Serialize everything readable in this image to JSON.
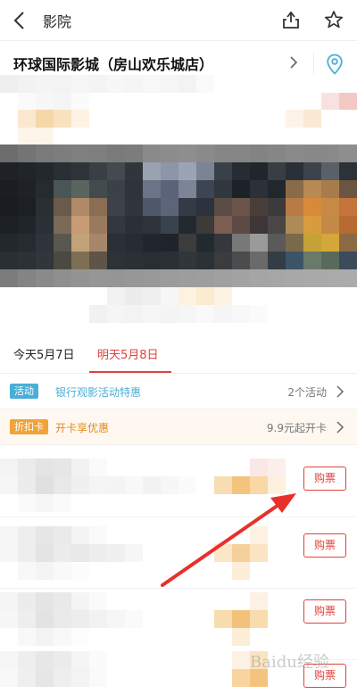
{
  "header": {
    "title": "影院"
  },
  "cinema": {
    "name": "环球国际影城（房山欢乐城店）"
  },
  "tabs": [
    {
      "label": "今天5月7日",
      "active": false
    },
    {
      "label": "明天5月8日",
      "active": true
    }
  ],
  "promos": [
    {
      "badge": "活动",
      "badge_color": "#4aaed6",
      "text": "银行观影活动特惠",
      "text_color": "#4aaed6",
      "right": "2个活动"
    },
    {
      "badge": "折扣卡",
      "badge_color": "#f0a33a",
      "text": "开卡享优惠",
      "text_color": "#e08a1f",
      "right": "9.9元起开卡"
    }
  ],
  "showtimes": [
    {
      "buy_label": "购票"
    },
    {
      "buy_label": "购票"
    },
    {
      "buy_label": "购票"
    },
    {
      "buy_label": "购票"
    }
  ],
  "watermark": "Baidu经验",
  "colors": {
    "accent": "#e0413b",
    "arrow": "#e8302b"
  }
}
